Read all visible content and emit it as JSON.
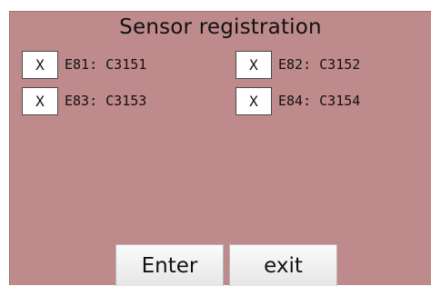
{
  "title": "Sensor registration",
  "sensors": [
    {
      "check": "X",
      "label": "E81: C3151"
    },
    {
      "check": "X",
      "label": "E82: C3152"
    },
    {
      "check": "X",
      "label": "E83: C3153"
    },
    {
      "check": "X",
      "label": "E84: C3154"
    }
  ],
  "buttons": {
    "enter": "Enter",
    "exit": "exit"
  },
  "colors": {
    "panel_bg": "#bf8a8b",
    "button_bg": "#f2f2f2"
  }
}
